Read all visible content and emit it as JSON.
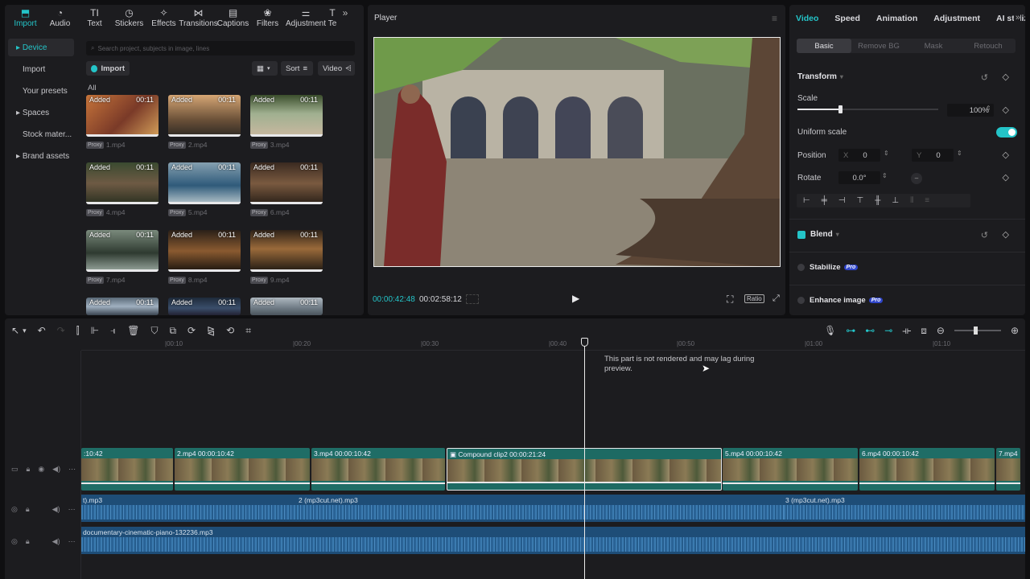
{
  "top_tools": [
    {
      "label": "Import",
      "icon": "import-icon"
    },
    {
      "label": "Audio",
      "icon": "audio-icon"
    },
    {
      "label": "Text",
      "icon": "text-icon"
    },
    {
      "label": "Stickers",
      "icon": "stickers-icon"
    },
    {
      "label": "Effects",
      "icon": "effects-icon"
    },
    {
      "label": "Transitions",
      "icon": "transitions-icon"
    },
    {
      "label": "Captions",
      "icon": "captions-icon"
    },
    {
      "label": "Filters",
      "icon": "filters-icon"
    },
    {
      "label": "Adjustment",
      "icon": "adjustment-icon"
    },
    {
      "label": "Te",
      "icon": "templates-icon"
    }
  ],
  "sidebar": {
    "items": [
      {
        "label": "Device"
      },
      {
        "label": "Import"
      },
      {
        "label": "Your presets"
      },
      {
        "label": "Spaces"
      },
      {
        "label": "Stock mater..."
      },
      {
        "label": "Brand assets"
      }
    ]
  },
  "media": {
    "search_placeholder": "Search project, subjects in image, lines",
    "import_label": "Import",
    "sort_label": "Sort",
    "filter_label": "Video",
    "all_label": "All",
    "added_label": "Added",
    "proxy_label": "Proxy",
    "items": [
      {
        "name": "1.mp4",
        "duration": "00:11"
      },
      {
        "name": "2.mp4",
        "duration": "00:11"
      },
      {
        "name": "3.mp4",
        "duration": "00:11"
      },
      {
        "name": "4.mp4",
        "duration": "00:11"
      },
      {
        "name": "5.mp4",
        "duration": "00:11"
      },
      {
        "name": "6.mp4",
        "duration": "00:11"
      },
      {
        "name": "7.mp4",
        "duration": "00:11"
      },
      {
        "name": "8.mp4",
        "duration": "00:11"
      },
      {
        "name": "9.mp4",
        "duration": "00:11"
      },
      {
        "name": "",
        "duration": "00:11"
      },
      {
        "name": "",
        "duration": "00:11"
      },
      {
        "name": "",
        "duration": "00:11"
      }
    ]
  },
  "player": {
    "title": "Player",
    "current_time": "00:00:42:48",
    "total_time": "00:02:58:12",
    "ratio_label": "Ratio"
  },
  "props": {
    "tabs": [
      "Video",
      "Speed",
      "Animation",
      "Adjustment",
      "AI stylize"
    ],
    "subtabs": [
      "Basic",
      "Remove BG",
      "Mask",
      "Retouch"
    ],
    "transform": "Transform",
    "scale_label": "Scale",
    "scale_value": "100%",
    "scale_fraction": 0.3,
    "uniform_scale": "Uniform scale",
    "position_label": "Position",
    "pos_x_label": "X",
    "pos_x": "0",
    "pos_y_label": "Y",
    "pos_y": "0",
    "rotate_label": "Rotate",
    "rotate_value": "0.0°",
    "blend": "Blend",
    "stabilize": "Stabilize",
    "enhance": "Enhance image",
    "pro_badge": "Pro"
  },
  "timeline": {
    "ruler": [
      "|00:10",
      "|00:20",
      "|00:30",
      "|00:40",
      "|00:50",
      "|01:00",
      "|01:10"
    ],
    "tooltip": "This part is not rendered and may lag during preview.",
    "clips": [
      {
        "label": ":10:42"
      },
      {
        "label": "2.mp4  00:00:10:42"
      },
      {
        "label": "3.mp4  00:00:10:42"
      },
      {
        "label": "Compound clip2  00:00:21:24"
      },
      {
        "label": "5.mp4  00:00:10:42"
      },
      {
        "label": "6.mp4  00:00:10:42"
      },
      {
        "label": "7.mp4"
      }
    ],
    "audio1": [
      {
        "label": "t).mp3"
      },
      {
        "label": "2 (mp3cut.net).mp3"
      },
      {
        "label": "3 (mp3cut.net).mp3"
      }
    ],
    "audio2": [
      {
        "label": "documentary-cinematic-piano-132236.mp3"
      }
    ]
  },
  "colors": {
    "accent": "#24c4c8",
    "clip": "#1f6d66",
    "audio": "#1e4d77"
  }
}
